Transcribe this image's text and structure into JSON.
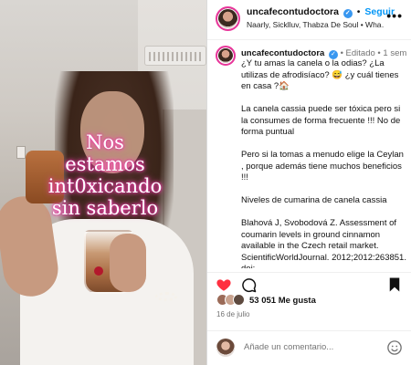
{
  "post": {
    "overlay_text": [
      "Nos",
      "estamos",
      "int0xicando",
      "sin saberlo"
    ]
  },
  "header": {
    "username": "uncafecontudoctora",
    "separator": "•",
    "follow_label": "Seguir",
    "audio": "Naarly, Sicklluv, Thabza De Soul • Wha…",
    "more_label": "•••"
  },
  "caption": {
    "username": "uncafecontudoctora",
    "edited": "• Editado •",
    "time": "1 sem",
    "paragraphs": [
      "¿Y tu amas la canela o la odias? ¿La utilizas de afrodisíaco? 😅 ¿y cuál tienes en casa ?🏠",
      "La canela cassia puede ser tóxica pero si la consumes de forma frecuente !!! No de forma puntual",
      " Pero si la tomas a menudo elige la Ceylan , porque además tiene muchos beneficios !!!",
      "Niveles de cumarina de canela cassia",
      "Blahová J, Svobodová Z. Assessment of coumarin levels in ground cinnamon available in the Czech retail market. ScientificWorldJournal. 2012;2012:263851. doi:"
    ]
  },
  "actions": {
    "like_icon": "heart-icon",
    "comment_icon": "comment-icon",
    "share_icon": "share-icon",
    "save_icon": "bookmark-icon",
    "like_color": "#ff3040"
  },
  "likes": {
    "text": "53 051 Me gusta"
  },
  "date": "16 de julio",
  "comment": {
    "placeholder": "Añade un comentario..."
  },
  "colors": {
    "accent": "#0095f6",
    "verified": "#3897f0",
    "story_ring": "#e8359a",
    "overlay_glow": "#ff4fb8"
  }
}
